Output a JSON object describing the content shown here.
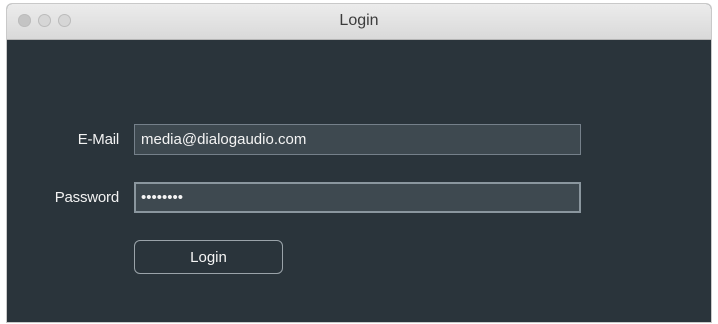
{
  "window": {
    "title": "Login"
  },
  "form": {
    "email_label": "E-Mail",
    "email_value": "media@dialogaudio.com",
    "password_label": "Password",
    "password_value": "password",
    "login_label": "Login"
  },
  "colors": {
    "background": "#2a343b",
    "field_background": "#3e4950",
    "field_border": "#75808a",
    "text": "#f2f2f2"
  }
}
